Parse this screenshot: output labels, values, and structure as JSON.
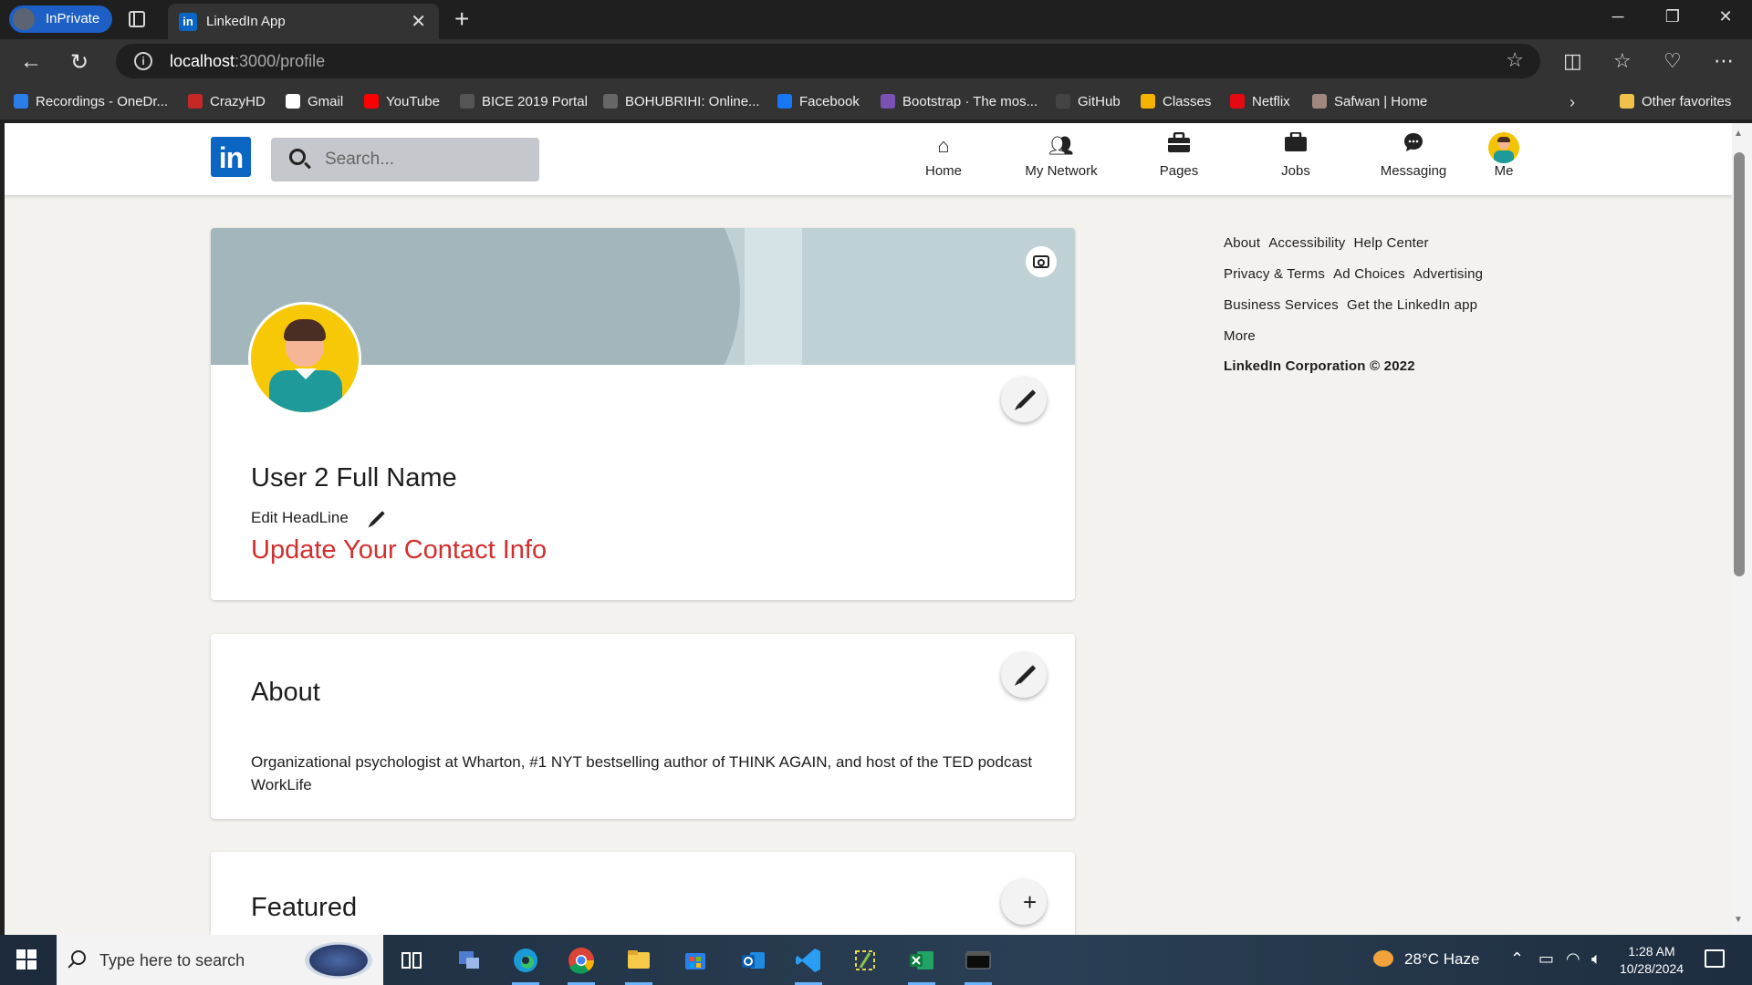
{
  "browser": {
    "inprivate_label": "InPrivate",
    "tab_title": "LinkedIn App",
    "favicon_text": "in",
    "url_host": "localhost",
    "url_path": ":3000/profile",
    "bookmarks": [
      {
        "label": "Recordings - OneDr...",
        "color": "#2b7de9"
      },
      {
        "label": "CrazyHD",
        "color": "#c62828"
      },
      {
        "label": "Gmail",
        "color": "#ffffff"
      },
      {
        "label": "YouTube",
        "color": "#ff0000"
      },
      {
        "label": "BICE 2019 Portal",
        "color": "#555555"
      },
      {
        "label": "BOHUBRIHI: Online...",
        "color": "#666666"
      },
      {
        "label": "Facebook",
        "color": "#1877f2"
      },
      {
        "label": "Bootstrap · The mos...",
        "color": "#7952b3"
      },
      {
        "label": "GitHub",
        "color": "#444444"
      },
      {
        "label": "Classes",
        "color": "#f4b400"
      },
      {
        "label": "Netflix",
        "color": "#e50914"
      },
      {
        "label": "Safwan | Home",
        "color": "#a1887f"
      }
    ],
    "other_favorites": "Other favorites"
  },
  "header": {
    "logo_text": "in",
    "search_placeholder": "Search...",
    "nav": [
      {
        "label": "Home",
        "icon": "home-icon"
      },
      {
        "label": "My Network",
        "icon": "people-icon"
      },
      {
        "label": "Pages",
        "icon": "briefcase-icon"
      },
      {
        "label": "Jobs",
        "icon": "work-icon"
      },
      {
        "label": "Messaging",
        "icon": "chat-icon"
      },
      {
        "label": "Me",
        "icon": "avatar"
      }
    ]
  },
  "profile": {
    "name": "User 2 Full Name",
    "headline": "Edit HeadLine",
    "contact_link": "Update Your Contact Info"
  },
  "about": {
    "title": "About",
    "text": "Organizational psychologist at Wharton, #1 NYT bestselling author of THINK AGAIN, and host of the TED podcast WorkLife"
  },
  "featured": {
    "title": "Featured"
  },
  "footer": {
    "rows": [
      [
        "About",
        "Accessibility",
        "Help Center"
      ],
      [
        "Privacy & Terms",
        "Ad Choices",
        "Advertising"
      ],
      [
        "Business Services",
        "Get the LinkedIn app"
      ],
      [
        "More"
      ]
    ],
    "corporation": "LinkedIn Corporation © 2022"
  },
  "taskbar": {
    "search_placeholder": "Type here to search",
    "weather": "28°C  Haze",
    "time": "1:28 AM",
    "date": "10/28/2024"
  },
  "colors": {
    "linkedin_blue": "#0a66c2",
    "contact_red": "#d32f2f",
    "page_bg": "#f3f2ef"
  }
}
